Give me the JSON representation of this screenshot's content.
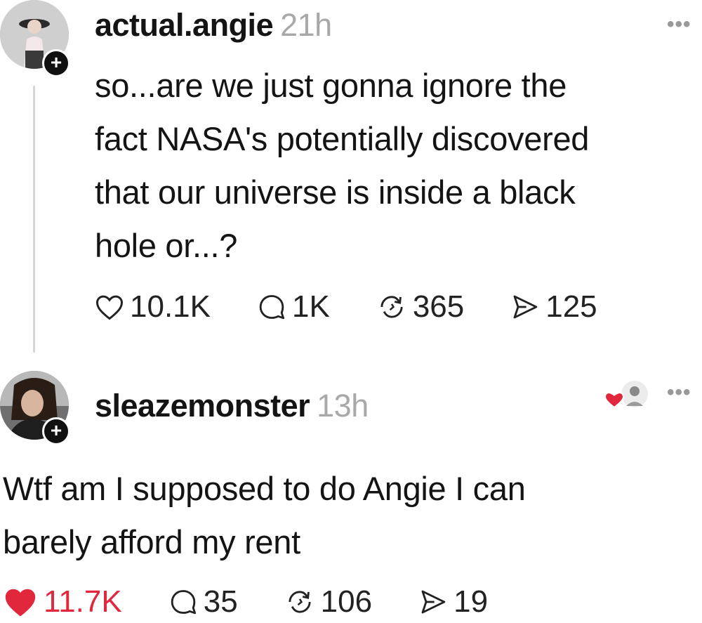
{
  "post1": {
    "username": "actual.angie",
    "time": "21h",
    "more": "•••",
    "follow_badge": "+",
    "text_lines": [
      "so...are we just gonna ignore the",
      "fact NASA's potentially discovered",
      "that our universe is inside a black",
      "hole or...?"
    ],
    "likes": "10.1K",
    "comments": "1K",
    "reposts": "365",
    "shares": "125",
    "liked": false
  },
  "post2": {
    "username": "sleazemonster",
    "time": "13h",
    "more": "•••",
    "follow_badge": "+",
    "text_lines": [
      "Wtf am I supposed to do Angie I can",
      "barely afford my rent"
    ],
    "likes": "11.7K",
    "comments": "35",
    "reposts": "106",
    "shares": "19",
    "liked": true
  },
  "colors": {
    "text": "#141414",
    "muted": "#a8a8a8",
    "heart_red": "#e0273c",
    "thread_line": "#d6d6d6"
  },
  "icons": [
    "heart-icon",
    "comment-icon",
    "repost-icon",
    "share-icon",
    "more-icon",
    "plus-icon"
  ]
}
